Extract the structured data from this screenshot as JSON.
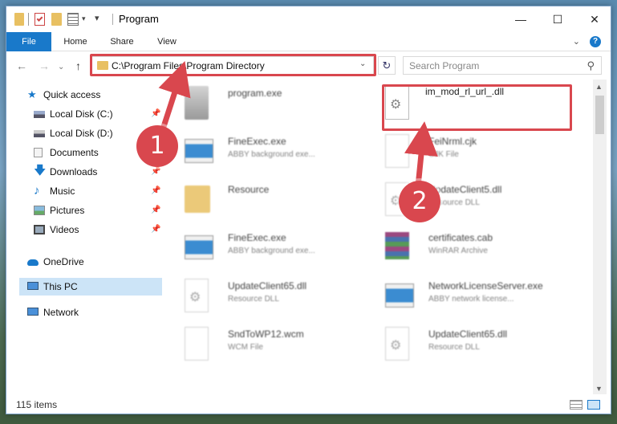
{
  "window": {
    "title": "Program"
  },
  "ribbon": {
    "tabs": [
      "File",
      "Home",
      "Share",
      "View"
    ],
    "help": "?"
  },
  "nav": {
    "address": "C:\\Program Files\\Program Directory",
    "search_placeholder": "Search Program",
    "back": "←",
    "forward": "→",
    "up": "↑",
    "refresh": "↻",
    "dropdown": "⌄"
  },
  "window_buttons": {
    "minimize": "—",
    "maximize": "☐",
    "close": "✕"
  },
  "sidebar": {
    "items": [
      {
        "label": "Quick access",
        "icon": "star-icon",
        "pinned": false
      },
      {
        "label": "Local Disk (C:)",
        "icon": "drive-icon",
        "pinned": true
      },
      {
        "label": "Local Disk (D:)",
        "icon": "drive-icon",
        "pinned": true
      },
      {
        "label": "Documents",
        "icon": "documents-icon",
        "pinned": true
      },
      {
        "label": "Downloads",
        "icon": "downloads-icon",
        "pinned": true
      },
      {
        "label": "Music",
        "icon": "music-icon",
        "pinned": true
      },
      {
        "label": "Pictures",
        "icon": "pictures-icon",
        "pinned": true
      },
      {
        "label": "Videos",
        "icon": "videos-icon",
        "pinned": true
      },
      {
        "label": "OneDrive",
        "icon": "cloud-icon",
        "pinned": false
      },
      {
        "label": "This PC",
        "icon": "pc-icon",
        "pinned": false
      },
      {
        "label": "Network",
        "icon": "network-icon",
        "pinned": false
      }
    ],
    "pin_glyph": "📌"
  },
  "files": [
    {
      "name": "program.exe",
      "sub": "",
      "icon": "exe-icon"
    },
    {
      "name": "im_mod_rl_url_.dll",
      "sub": "",
      "icon": "dll-gear-icon"
    },
    {
      "name": "FineExec.exe",
      "sub": "ABBY background exe...",
      "icon": "window-app-icon"
    },
    {
      "name": "FeiNrml.cjk",
      "sub": "CJK File",
      "icon": "blank-file-icon"
    },
    {
      "name": "Resource",
      "sub": "",
      "icon": "folder-icon"
    },
    {
      "name": "UpdateClient5.dll",
      "sub": "Resource DLL",
      "icon": "dll-gear-icon"
    },
    {
      "name": "FineExec.exe",
      "sub": "ABBY background exe...",
      "icon": "window-app-icon"
    },
    {
      "name": "certificates.cab",
      "sub": "WinRAR Archive",
      "icon": "winrar-icon"
    },
    {
      "name": "UpdateClient65.dll",
      "sub": "Resource DLL",
      "icon": "dll-gear-icon"
    },
    {
      "name": "NetworkLicenseServer.exe",
      "sub": "ABBY network license...",
      "icon": "window-app-icon"
    },
    {
      "name": "SndToWP12.wcm",
      "sub": "WCM File",
      "icon": "blank-file-icon"
    },
    {
      "name": "UpdateClient65.dll",
      "sub": "Resource DLL",
      "icon": "dll-gear-icon"
    }
  ],
  "status": {
    "items": "115 items"
  },
  "annotations": {
    "step1": "1",
    "step2": "2"
  },
  "colors": {
    "accent": "#1979ca",
    "highlight": "#d9474e",
    "selected": "#cce4f7"
  }
}
